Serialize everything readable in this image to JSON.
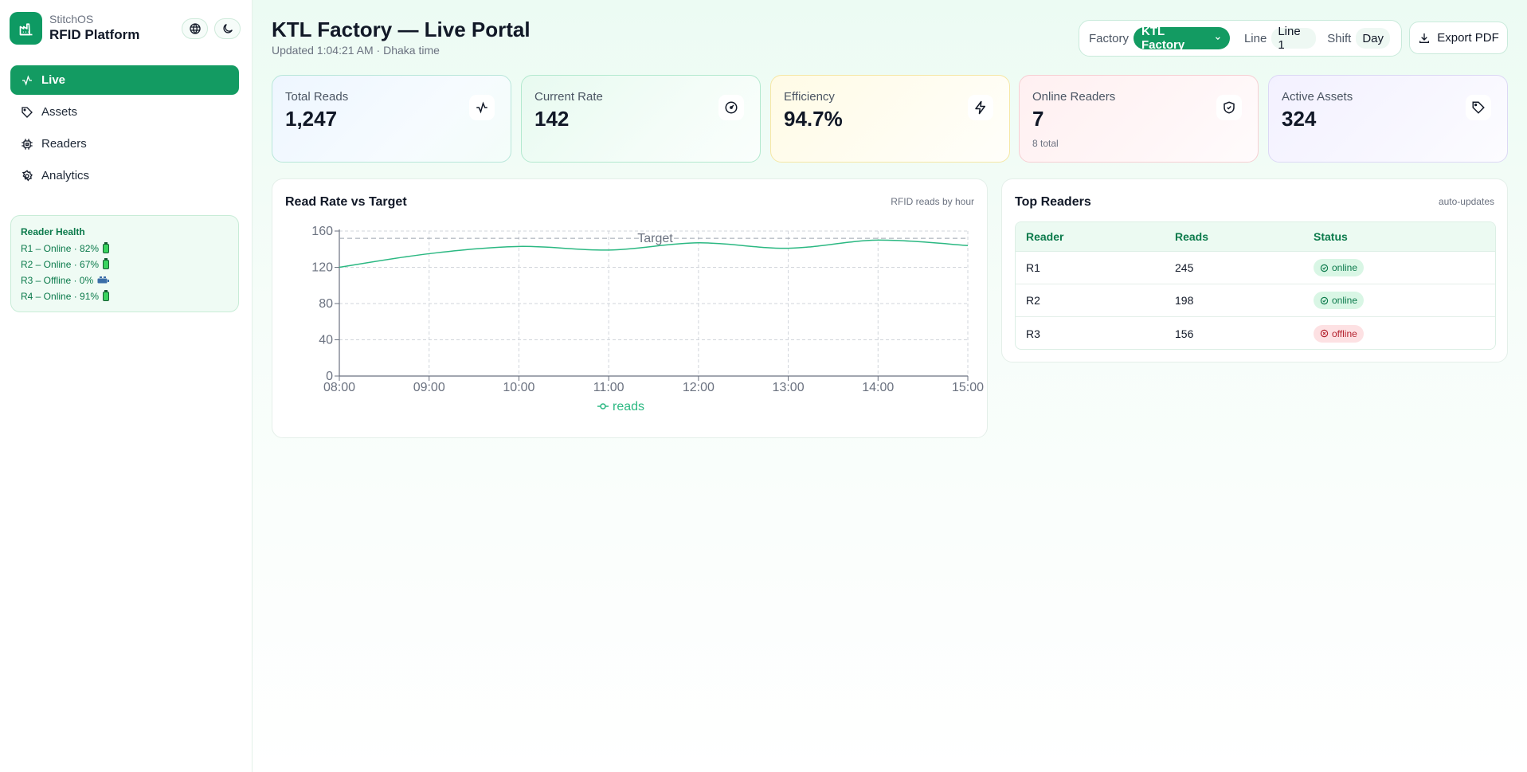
{
  "sidebar": {
    "brand_sub": "StitchOS",
    "brand_title": "RFID Platform",
    "nav": [
      {
        "label": "Live",
        "icon": "activity-icon",
        "active": true
      },
      {
        "label": "Assets",
        "icon": "tag-icon",
        "active": false
      },
      {
        "label": "Readers",
        "icon": "chip-icon",
        "active": false
      },
      {
        "label": "Analytics",
        "icon": "gear-icon",
        "active": false
      }
    ],
    "health": {
      "title": "Reader Health",
      "rows": [
        {
          "text": "R1 – Online · 82%",
          "battery": "battery-icon"
        },
        {
          "text": "R2 – Online · 67%",
          "battery": "battery-icon"
        },
        {
          "text": "R3 – Offline · 0%",
          "battery": "battery-empty-icon"
        },
        {
          "text": "R4 – Online · 91%",
          "battery": "battery-icon"
        }
      ]
    }
  },
  "header": {
    "title": "KTL Factory — Live Portal",
    "updated": "Updated 1:04:21 AM · Dhaka time",
    "factory_label": "Factory",
    "factory_value": "KTL Factory",
    "line_label": "Line",
    "line_value": "Line 1",
    "shift_label": "Shift",
    "shift_value": "Day",
    "export_label": "Export PDF"
  },
  "kpis": [
    {
      "label": "Total Reads",
      "value": "1,247",
      "sub": "",
      "icon": "activity-icon"
    },
    {
      "label": "Current Rate",
      "value": "142",
      "sub": "",
      "icon": "gauge-icon"
    },
    {
      "label": "Efficiency",
      "value": "94.7%",
      "sub": "",
      "icon": "bolt-icon"
    },
    {
      "label": "Online Readers",
      "value": "7",
      "sub": "8 total",
      "icon": "shield-check-icon"
    },
    {
      "label": "Active Assets",
      "value": "324",
      "sub": "",
      "icon": "tag-icon"
    }
  ],
  "chart_card": {
    "title": "Read Rate vs Target",
    "note": "RFID reads by hour"
  },
  "chart_data": {
    "type": "line",
    "x": [
      "08:00",
      "09:00",
      "10:00",
      "11:00",
      "12:00",
      "13:00",
      "14:00",
      "15:00"
    ],
    "series": [
      {
        "name": "reads",
        "values": [
          120,
          135,
          143,
          139,
          147,
          141,
          150,
          144
        ]
      }
    ],
    "target": {
      "label": "Target",
      "value": 152
    },
    "ylim": [
      0,
      160
    ],
    "yticks": [
      0,
      40,
      80,
      120,
      160
    ],
    "grid": true,
    "legend": "bottom",
    "colors": {
      "reads": "#2bb882",
      "target": "#9ca3af"
    }
  },
  "table_card": {
    "title": "Top Readers",
    "note": "auto-updates",
    "columns": [
      "Reader",
      "Reads",
      "Status"
    ],
    "rows": [
      {
        "reader": "R1",
        "reads": "245",
        "status": "online"
      },
      {
        "reader": "R2",
        "reads": "198",
        "status": "online"
      },
      {
        "reader": "R3",
        "reads": "156",
        "status": "offline"
      }
    ]
  }
}
